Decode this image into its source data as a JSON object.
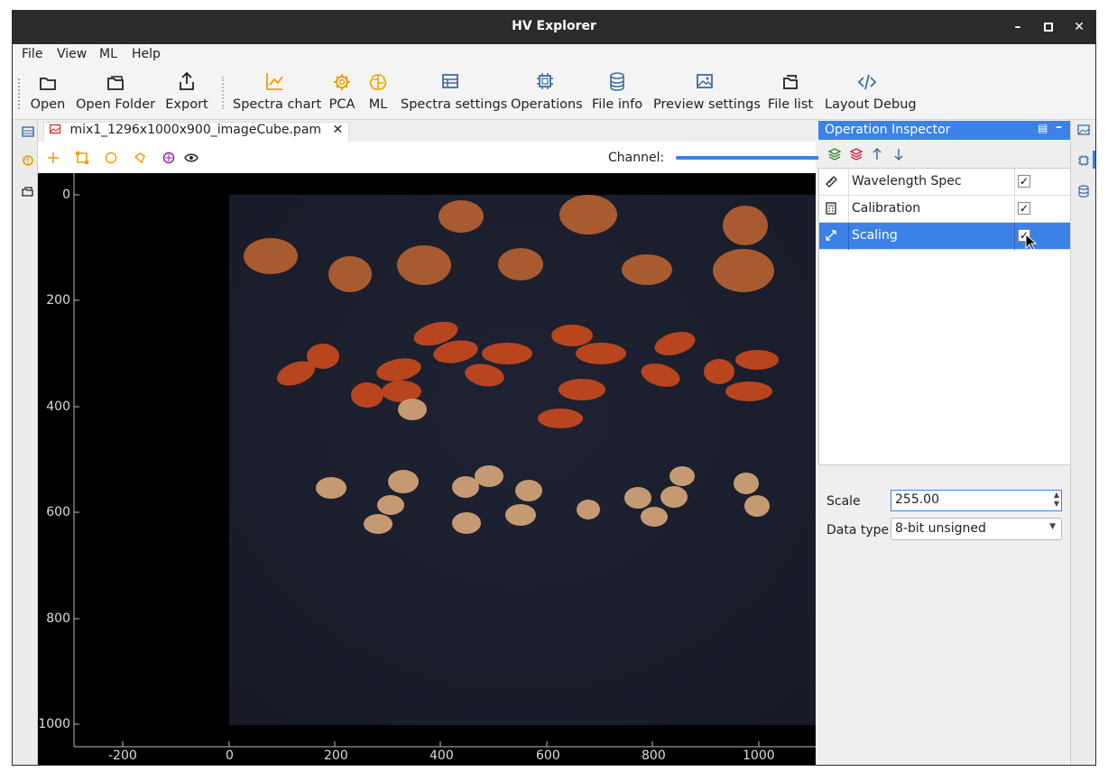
{
  "window": {
    "title": "HV Explorer"
  },
  "menu": [
    "File",
    "View",
    "ML",
    "Help"
  ],
  "toolbar": {
    "open": "Open",
    "open_folder": "Open Folder",
    "export": "Export",
    "spectra_chart": "Spectra chart",
    "pca": "PCA",
    "ml": "ML",
    "spectra_settings": "Spectra settings",
    "operations": "Operations",
    "file_info": "File info",
    "preview_settings": "Preview settings",
    "file_list": "File list",
    "layout_debug": "Layout Debug"
  },
  "document": {
    "tab_name": "mix1_1296x1000x900_imageCube.pam",
    "channel_label": "Channel:"
  },
  "plot": {
    "y_ticks": [
      "0",
      "200",
      "400",
      "600",
      "800",
      "1000"
    ],
    "x_ticks": [
      "-200",
      "0",
      "200",
      "400",
      "600",
      "800",
      "1000"
    ]
  },
  "inspector": {
    "title": "Operation Inspector",
    "operations": [
      {
        "name": "Wavelength Spec",
        "enabled": true
      },
      {
        "name": "Calibration",
        "enabled": true
      },
      {
        "name": "Scaling",
        "enabled": true
      }
    ],
    "scale_label": "Scale",
    "scale_value": "255.00",
    "data_type_label": "Data type",
    "data_type_value": "8-bit unsigned"
  },
  "colors": {
    "accent": "#3c82e6",
    "titlebar": "#2b2b2b",
    "orange_icon": "#f0a000"
  }
}
